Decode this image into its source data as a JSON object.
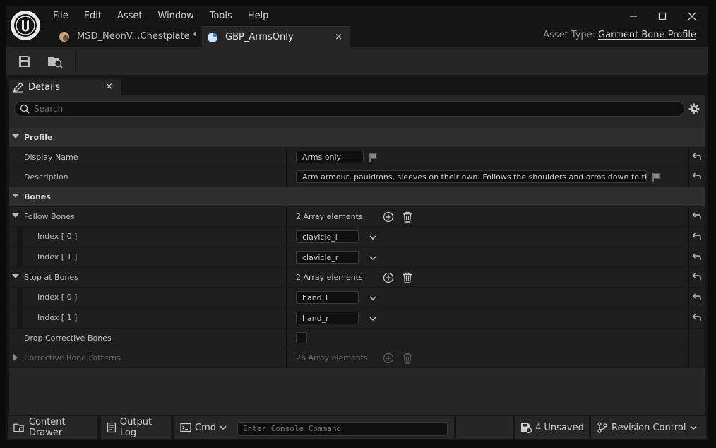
{
  "menu": [
    "File",
    "Edit",
    "Asset",
    "Window",
    "Tools",
    "Help"
  ],
  "tabs": [
    {
      "label": "MSD_NeonV...Chestplate *",
      "active": false
    },
    {
      "label": "GBP_ArmsOnly",
      "active": true,
      "close": "×"
    }
  ],
  "asset_type": {
    "label": "Asset Type:",
    "value": "Garment Bone Profile"
  },
  "details_tab": {
    "label": "Details",
    "close": "×"
  },
  "search": {
    "placeholder": "Search"
  },
  "details": {
    "profile": {
      "category": "Profile",
      "display_name": {
        "label": "Display Name",
        "value": "Arms only"
      },
      "description": {
        "label": "Description",
        "value": "Arm armour, pauldrons, sleeves on their own. Follows the shoulders and arms down to the wrist."
      }
    },
    "bones": {
      "category": "Bones",
      "follow_bones": {
        "label": "Follow Bones",
        "summary": "2 Array elements",
        "items": [
          {
            "index": "Index [ 0 ]",
            "value": "clavicle_l"
          },
          {
            "index": "Index [ 1 ]",
            "value": "clavicle_r"
          }
        ]
      },
      "stop_at_bones": {
        "label": "Stop at Bones",
        "summary": "2 Array elements",
        "items": [
          {
            "index": "Index [ 0 ]",
            "value": "hand_l"
          },
          {
            "index": "Index [ 1 ]",
            "value": "hand_r"
          }
        ]
      },
      "drop_corrective": {
        "label": "Drop Corrective Bones",
        "checked": false
      },
      "corrective_patterns": {
        "label": "Corrective Bone Patterns",
        "summary": "26 Array elements"
      }
    }
  },
  "statusbar": {
    "content_drawer": "Content Drawer",
    "output_log": "Output Log",
    "cmd": "Cmd",
    "console_placeholder": "Enter Console Command",
    "unsaved": "4 Unsaved",
    "revision_control": "Revision Control"
  },
  "colors": {
    "background": "#151515",
    "panel": "#262626",
    "row": "#1e1e1e",
    "category_row": "#2e2e2e",
    "input": "#0f0f0f"
  }
}
